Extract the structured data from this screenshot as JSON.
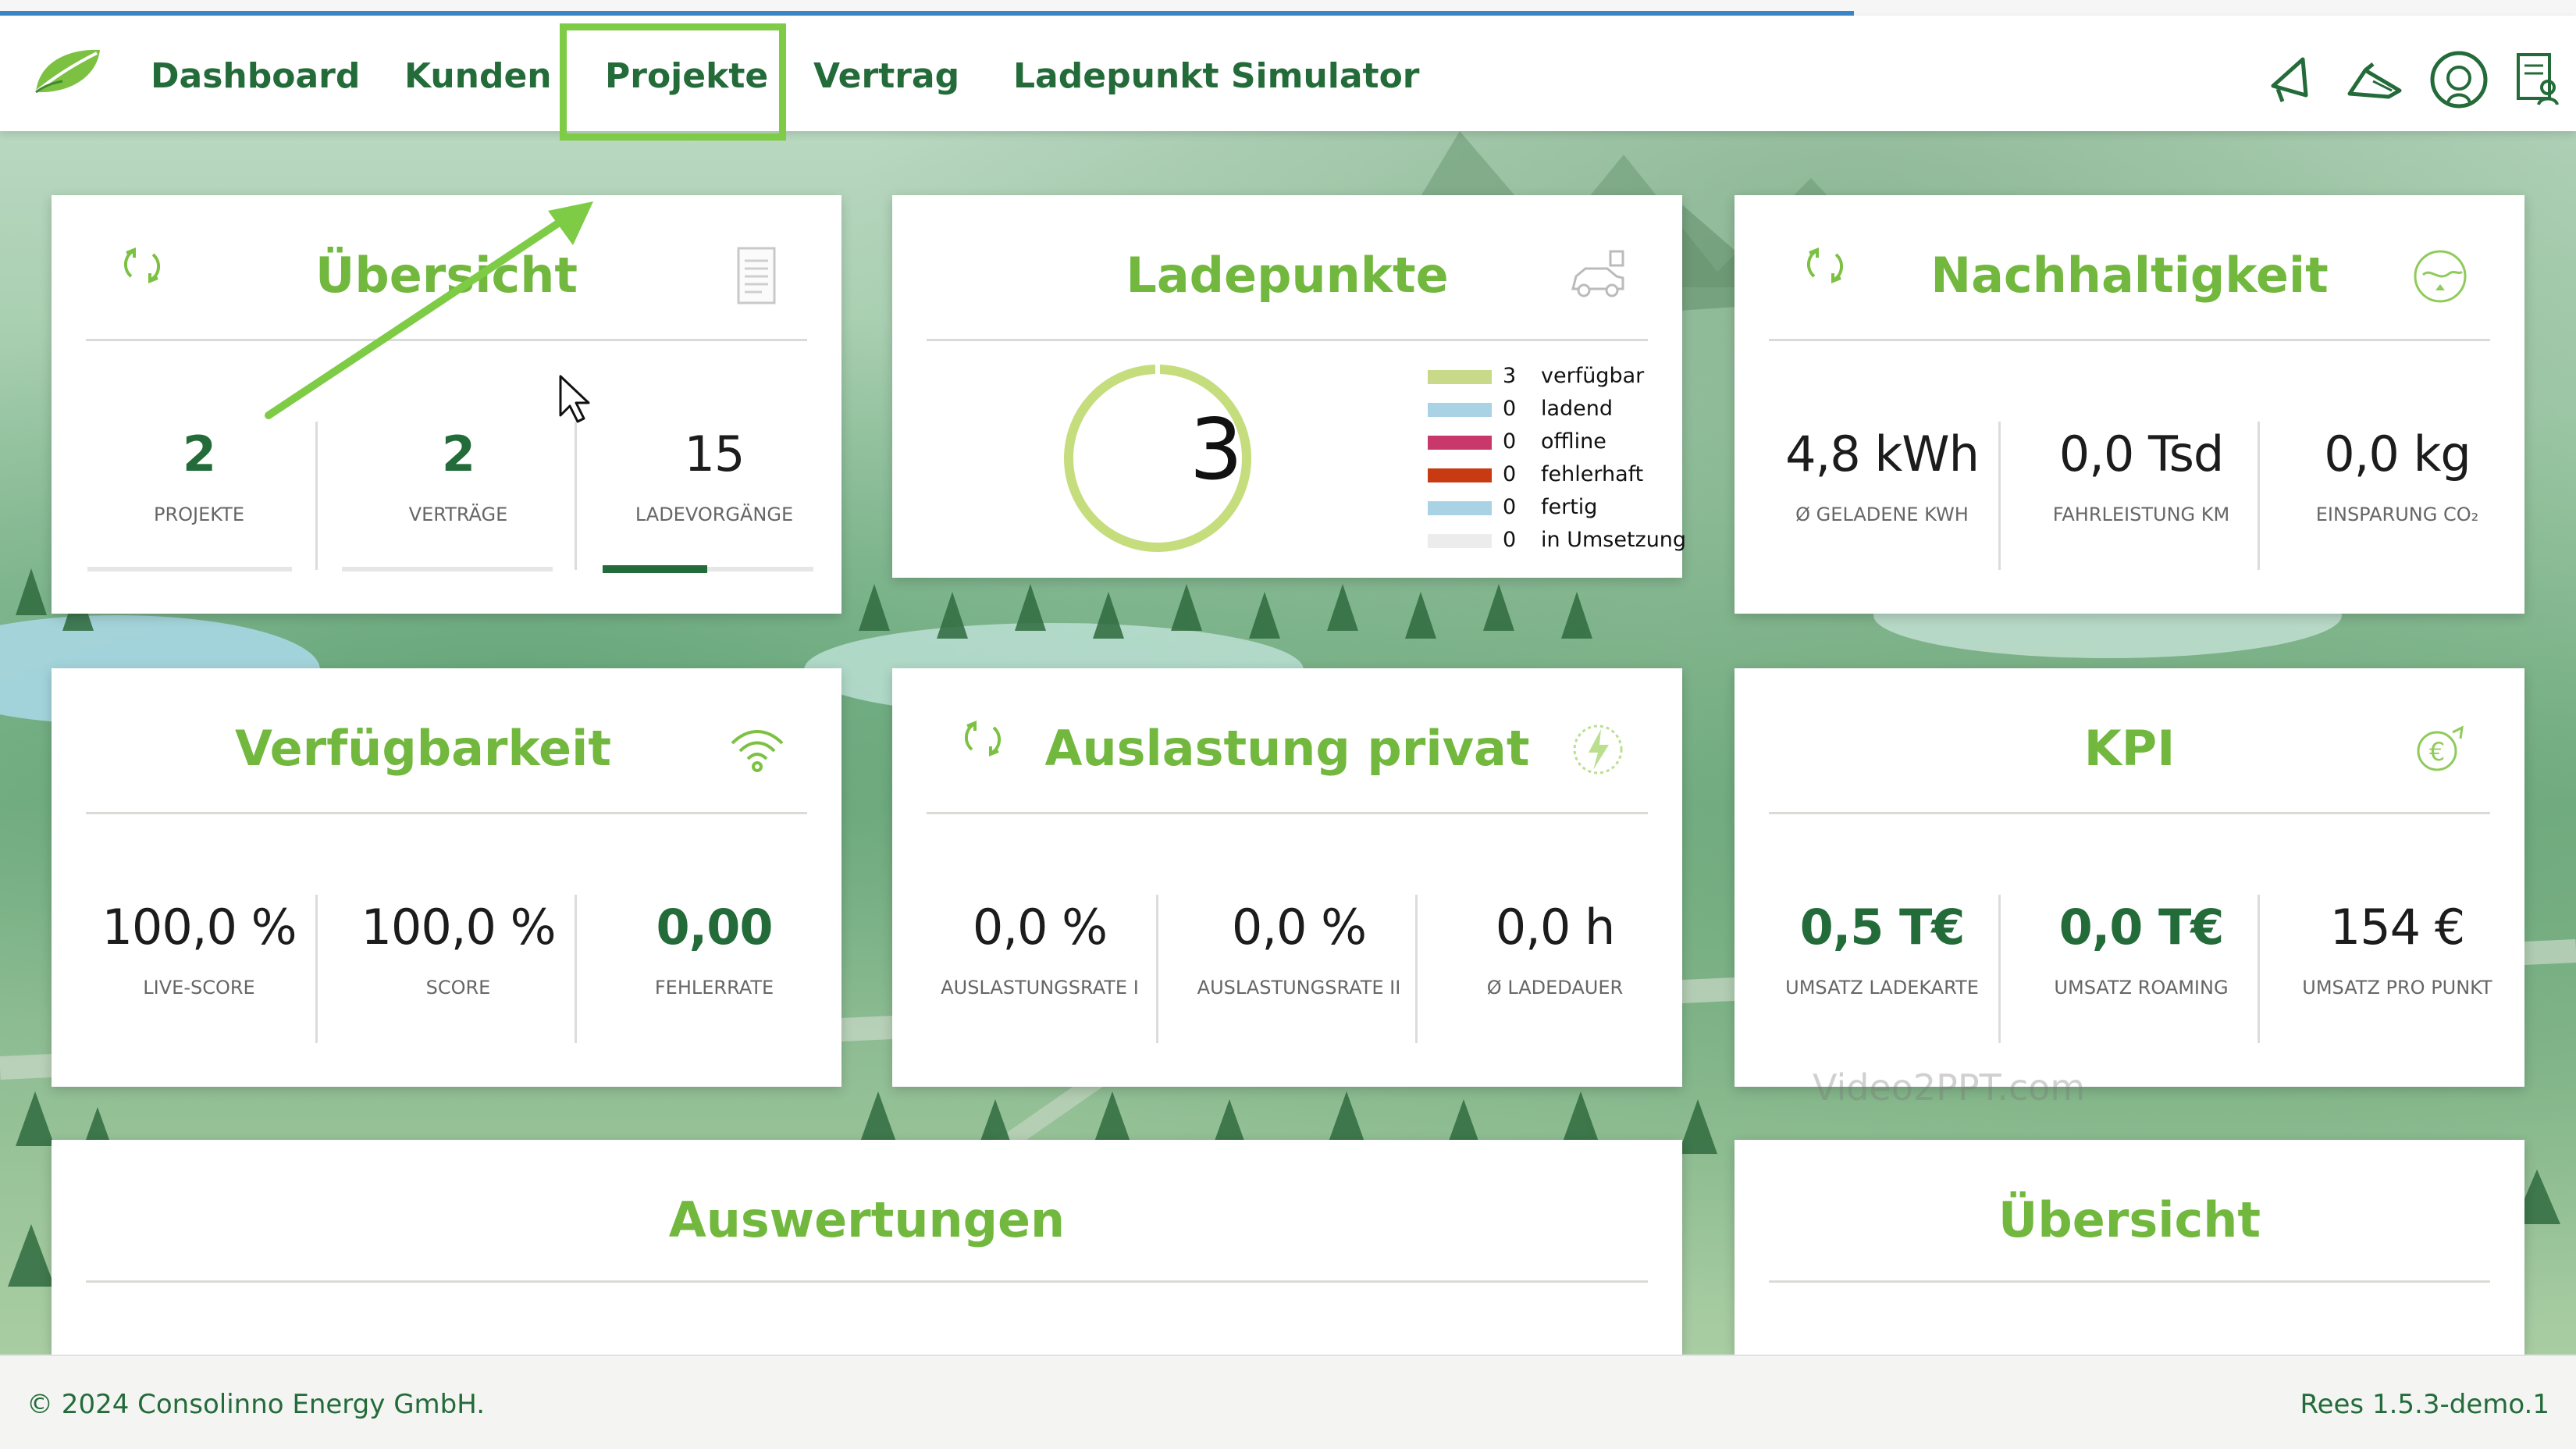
{
  "nav": {
    "items": [
      {
        "label": "Dashboard"
      },
      {
        "label": "Kunden"
      },
      {
        "label": "Projekte"
      },
      {
        "label": "Vertrag"
      },
      {
        "label": "Ladepunkt Simulator"
      }
    ],
    "active_item": "Projekte",
    "icons": [
      "megaphone-icon",
      "announcement-icon",
      "support-headset-icon",
      "document-user-icon"
    ]
  },
  "cards": {
    "uebersicht": {
      "title": "Übersicht",
      "stats": [
        {
          "value": "2",
          "label": "PROJEKTE"
        },
        {
          "value": "2",
          "label": "VERTRÄGE"
        },
        {
          "value": "15",
          "label": "LADEVORGÄNGE"
        }
      ]
    },
    "ladepunkte": {
      "title": "Ladepunkte",
      "total": "3",
      "legend": [
        {
          "count": "3",
          "label": "verfügbar",
          "color": "#c8da8a"
        },
        {
          "count": "0",
          "label": "ladend",
          "color": "#a9d2e4"
        },
        {
          "count": "0",
          "label": "offline",
          "color": "#c9386a"
        },
        {
          "count": "0",
          "label": "fehlerhaft",
          "color": "#c83a12"
        },
        {
          "count": "0",
          "label": "fertig",
          "color": "#a9d2e4"
        },
        {
          "count": "0",
          "label": "in Umsetzung",
          "color": "#ececec"
        }
      ]
    },
    "nachhaltigkeit": {
      "title": "Nachhaltigkeit",
      "stats": [
        {
          "value": "4,8 kWh",
          "label": "Ø GELADENE KWH"
        },
        {
          "value": "0,0 Tsd",
          "label": "FAHRLEISTUNG KM"
        },
        {
          "value": "0,0 kg",
          "label": "EINSPARUNG CO₂"
        }
      ]
    },
    "verfuegbarkeit": {
      "title": "Verfügbarkeit",
      "stats": [
        {
          "value": "100,0 %",
          "label": "LIVE-SCORE"
        },
        {
          "value": "100,0 %",
          "label": "SCORE"
        },
        {
          "value": "0,00",
          "label": "FEHLERRATE"
        }
      ]
    },
    "auslastung": {
      "title": "Auslastung privat",
      "stats": [
        {
          "value": "0,0 %",
          "label": "AUSLASTUNGSRATE I"
        },
        {
          "value": "0,0 %",
          "label": "AUSLASTUNGSRATE II"
        },
        {
          "value": "0,0 h",
          "label": "Ø LADEDAUER"
        }
      ]
    },
    "kpi": {
      "title": "KPI",
      "stats": [
        {
          "value": "0,5 T€",
          "label": "UMSATZ LADEKARTE"
        },
        {
          "value": "0,0 T€",
          "label": "UMSATZ ROAMING"
        },
        {
          "value": "154 €",
          "label": "UMSATZ PRO PUNKT"
        }
      ]
    },
    "auswertungen": {
      "title": "Auswertungen"
    },
    "uebersicht2": {
      "title": "Übersicht"
    }
  },
  "watermark": "Video2PPT.com",
  "footer": {
    "copyright": "© 2024 Consolinno Energy GmbH.",
    "version": "Rees 1.5.3-demo.1"
  },
  "colors": {
    "accent_green": "#72b83e",
    "dark_green": "#246b3a",
    "highlight_box": "#7ecb45",
    "progress_blue": "#3b86c9"
  }
}
